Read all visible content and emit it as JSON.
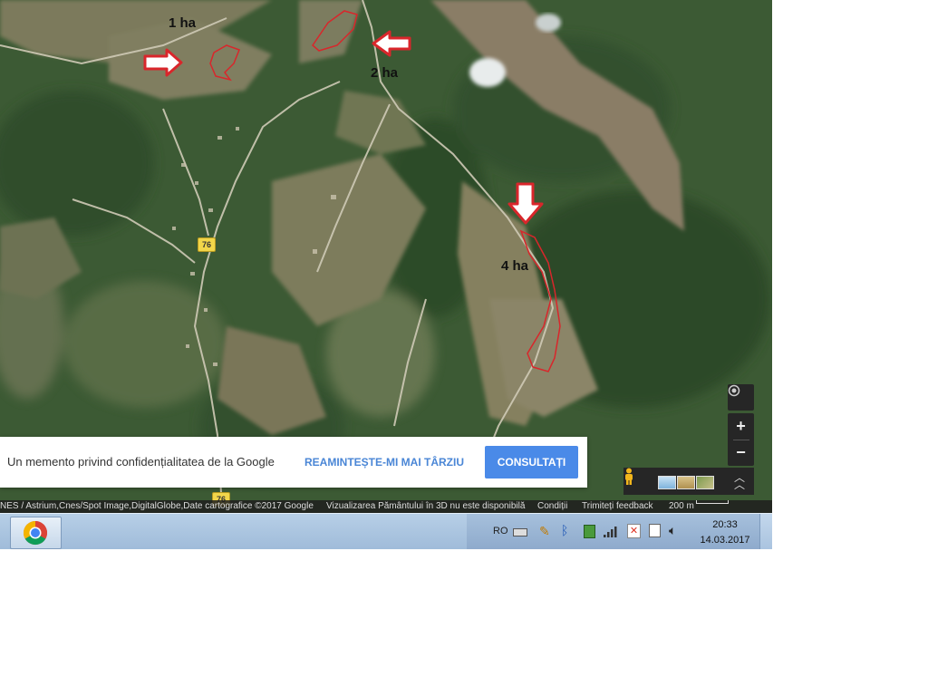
{
  "map": {
    "area_labels": [
      "1 ha",
      "2 ha",
      "4 ha"
    ],
    "road_number": "76"
  },
  "privacy_notice": {
    "text": "Un memento privind confidențialitatea de la Google",
    "remind_later_label": "REAMINTEȘTE-MI MAI TÂRZIU",
    "consult_label": "CONSULTAȚI"
  },
  "attribution": {
    "imagery": "NES / Astrium,Cnes/Spot Image,DigitalGlobe,Date cartografice ©2017 Google",
    "earth_3d": "Vizualizarea Pământului în 3D nu este disponibilă",
    "terms": "Condiții",
    "feedback": "Trimiteți feedback",
    "scale": "200 m"
  },
  "taskbar": {
    "language": "RO",
    "time": "20:33",
    "date": "14.03.2017",
    "pinned_app_icon": "chrome-icon"
  },
  "colors": {
    "annotation_red": "#d9262b",
    "accent_blue": "#4a8ae8"
  }
}
